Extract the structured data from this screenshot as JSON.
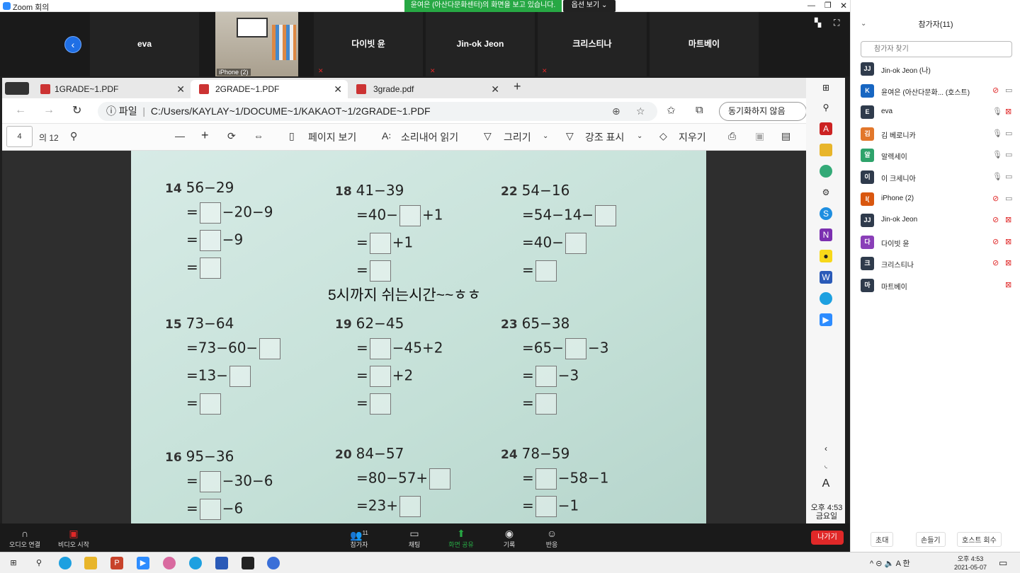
{
  "window": {
    "title": "Zoom 회의"
  },
  "banner": {
    "share_text": "윤여은 (아산다문화센터)의 화면을 보고 있습니다.",
    "view_options": "옵션 보기 ⌄"
  },
  "gallery": {
    "tiles": [
      "eva",
      "다이빗 윤",
      "Jin-ok Jeon",
      "크리스티나",
      "마트베이"
    ],
    "iphone_label": "iPhone (2)"
  },
  "browser": {
    "tabs": [
      "1GRADE~1.PDF",
      "2GRADE~1.PDF",
      "3grade.pdf"
    ],
    "url_prefix": "파일",
    "url": "C:/Users/KAYLAY~1/DOCUME~1/KAKAOT~1/2GRADE~1.PDF",
    "sync_button": "동기화하지 않음"
  },
  "pdf_toolbar": {
    "page_number": "4",
    "page_total": "의 12",
    "page_view": "페이지 보기",
    "read_aloud": "소리내어 읽기",
    "draw": "그리기",
    "highlight": "강조 표시",
    "erase": "지우기"
  },
  "document": {
    "overlay_message": "5시까지 쉬는시간~~ㅎㅎ",
    "problems": [
      {
        "num": "14",
        "expr": "56−29",
        "lines": [
          "=□−20−9",
          "=□−9",
          "=□"
        ]
      },
      {
        "num": "18",
        "expr": "41−39",
        "lines": [
          "=40−□+1",
          "=□+1",
          "=□"
        ]
      },
      {
        "num": "22",
        "expr": "54−16",
        "lines": [
          "=54−14−□",
          "=40−□",
          "=□"
        ]
      },
      {
        "num": "15",
        "expr": "73−64",
        "lines": [
          "=73−60−□",
          "=13−□",
          "=□"
        ]
      },
      {
        "num": "19",
        "expr": "62−45",
        "lines": [
          "=□−45+2",
          "=□+2",
          "=□"
        ]
      },
      {
        "num": "23",
        "expr": "65−38",
        "lines": [
          "=65−□−3",
          "=□−3",
          "=□"
        ]
      },
      {
        "num": "16",
        "expr": "95−36",
        "lines": [
          "=□−30−6",
          "=□−6"
        ]
      },
      {
        "num": "20",
        "expr": "84−57",
        "lines": [
          "=80−57+□",
          "=23+□"
        ]
      },
      {
        "num": "24",
        "expr": "78−59",
        "lines": [
          "=□−58−1",
          "=□−1"
        ]
      }
    ]
  },
  "participants": {
    "title": "참가자(11)",
    "search_placeholder": "참가자 찾기",
    "list": [
      {
        "initials": "JJ",
        "name": "Jin-ok Jeon (나)",
        "color": "#2f3b4c",
        "mic": "",
        "cam": ""
      },
      {
        "initials": "K",
        "name": "윤여은 (아산다문화...   (호스트)",
        "color": "#1766c2",
        "mic": "muted",
        "cam": "on"
      },
      {
        "initials": "E",
        "name": "eva",
        "color": "#2f3b4c",
        "mic": "on",
        "cam": "off"
      },
      {
        "initials": "김",
        "name": "김 베로니카",
        "color": "#e2772b",
        "mic": "on",
        "cam": "on"
      },
      {
        "initials": "알",
        "name": "알렉세이",
        "color": "#2ea36b",
        "mic": "on",
        "cam": "on"
      },
      {
        "initials": "이",
        "name": "이 크세니아",
        "color": "#2f3b4c",
        "mic": "on",
        "cam": "on"
      },
      {
        "initials": "I(",
        "name": "iPhone (2)",
        "color": "#d9570f",
        "mic": "muted",
        "cam": "on"
      },
      {
        "initials": "JJ",
        "name": "Jin-ok Jeon",
        "color": "#2f3b4c",
        "mic": "muted",
        "cam": "off"
      },
      {
        "initials": "다",
        "name": "다이빗 윤",
        "color": "#8a3fb8",
        "mic": "muted",
        "cam": "off"
      },
      {
        "initials": "크",
        "name": "크리스티나",
        "color": "#2f3b4c",
        "mic": "muted",
        "cam": "off"
      },
      {
        "initials": "마",
        "name": "마트베이",
        "color": "#2f3b4c",
        "mic": "",
        "cam": "off"
      }
    ],
    "invite": "초대",
    "raise_hand": "손들기",
    "reclaim_host": "호스트 회수"
  },
  "zoom_toolbar": {
    "audio": "오디오 연결",
    "video": "비디오 시작",
    "participants": "참가자",
    "participants_count": "11",
    "chat": "채팅",
    "share": "화면 공유",
    "record": "기록",
    "reactions": "반응",
    "leave": "나가기"
  },
  "sidebar_clock": {
    "time": "오후 4:53",
    "day": "금요일"
  },
  "taskbar": {
    "time": "오후 4:53",
    "date": "2021-05-07",
    "ime": "A",
    "ime2": "한"
  },
  "colors": {
    "share_green": "#27a844",
    "leave_red": "#e02828",
    "zoom_blue": "#2d8cff"
  }
}
